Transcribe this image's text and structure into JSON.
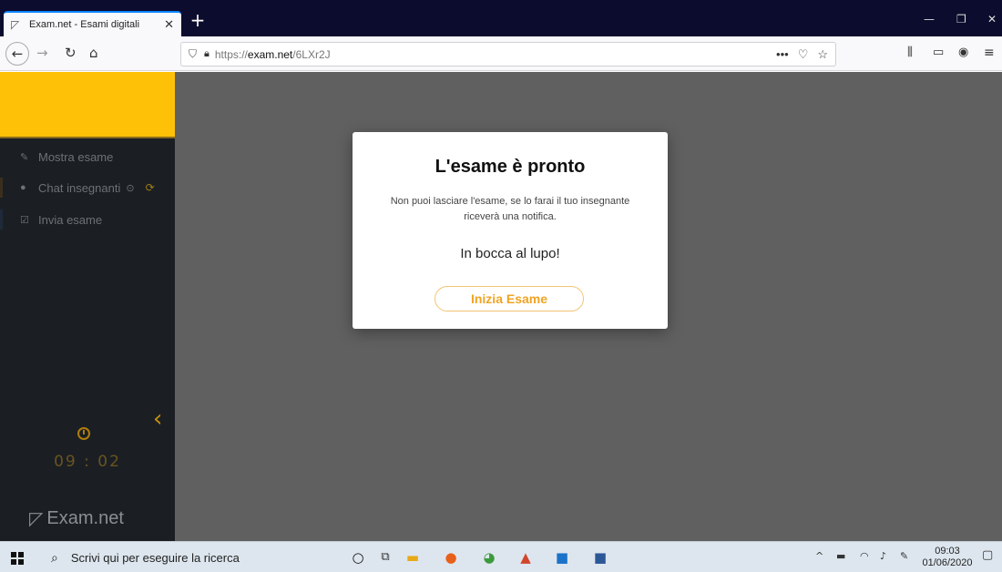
{
  "browser": {
    "tab_title": "Exam.net - Esami digitali",
    "new_tab_label": "+",
    "url_prefix": "https://",
    "url_host": "exam.net",
    "url_path": "/6LXr2J"
  },
  "sidebar": {
    "items": [
      {
        "label": "Mostra esame",
        "icon": "edit-icon"
      },
      {
        "label": "Chat insegnanti",
        "icon": "chat-icon"
      },
      {
        "label": "Invia esame",
        "icon": "checkbox-icon"
      }
    ],
    "timer": "09 : 02",
    "brand": "Exam.net"
  },
  "modal": {
    "title": "L'esame è pronto",
    "message": "Non puoi lasciare l'esame, se lo farai il tuo insegnante riceverà una notifica.",
    "luck": "In bocca al lupo!",
    "start_button": "Inizia Esame"
  },
  "taskbar": {
    "search_placeholder": "Scrivi qui per eseguire la ricerca",
    "time": "09:03",
    "date": "01/06/2020"
  },
  "colors": {
    "accent": "#ffc107",
    "button_text": "#f0a423",
    "sidebar_bg": "#1b1f24",
    "overlay": "#606060"
  }
}
